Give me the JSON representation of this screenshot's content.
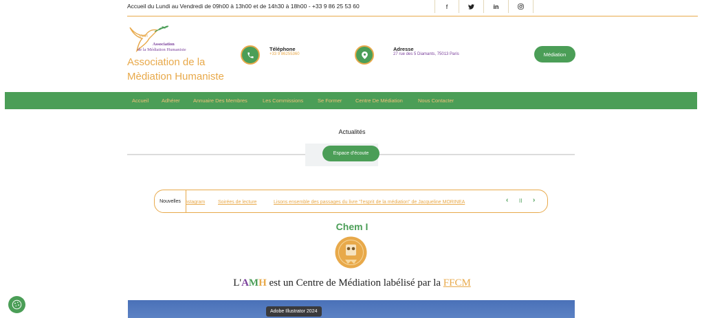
{
  "topbar": {
    "hours": "Accueil du Lundi au Vendredi de 09h00 à 13h00 et de 14h30 à 18h00 - +33 9 86 25 53 60",
    "social": [
      {
        "icon": "facebook-icon",
        "glyph": "f"
      },
      {
        "icon": "twitter-icon",
        "glyph": "🐦"
      },
      {
        "icon": "linkedin-icon",
        "glyph": "in"
      },
      {
        "icon": "instagram-icon",
        "glyph": "◎"
      }
    ]
  },
  "logo": {
    "line1": "Association",
    "line2": "de la Médiation Humaniste",
    "monogram": "AMH"
  },
  "site_title": "Association de la Mèdiation Humaniste",
  "contact": {
    "phone_label": "Téléphone",
    "phone_value": "+33 9 86255360",
    "address_label": "Adresse",
    "address_value": "27 rue des 5 Diamants, 75013 Paris"
  },
  "header_button": "Médiation",
  "nav": [
    "Accueil",
    "Adhérer",
    "Annuaire Des Membres",
    "Les Commissions",
    "Se Former",
    "Centre De Médiation",
    "Nous Contacter"
  ],
  "actualites": {
    "title": "Actualités",
    "button": "Espace d'écoute"
  },
  "ticker": {
    "label": "Nouvelles",
    "items": [
      "nstagram",
      "Soirées de lecture",
      "Lisons ensemble des passages du livre \"l'esprit de la médiation\" de Jacqueline MORINEA"
    ],
    "controls": {
      "prev": "‹",
      "pause": "II",
      "next": "›"
    }
  },
  "chem_heading": "Chem I",
  "label_sentence": {
    "prefix": "L'",
    "a": "A",
    "m": "M",
    "h": "H",
    "middle": " est un Centre de Médiation labélisé par la ",
    "link": "FFCM"
  },
  "tooltip": "Adobe Illustrator 2024",
  "colors": {
    "green": "#4b9e57",
    "gold": "#e8a94a",
    "purple": "#7a3f9b"
  }
}
